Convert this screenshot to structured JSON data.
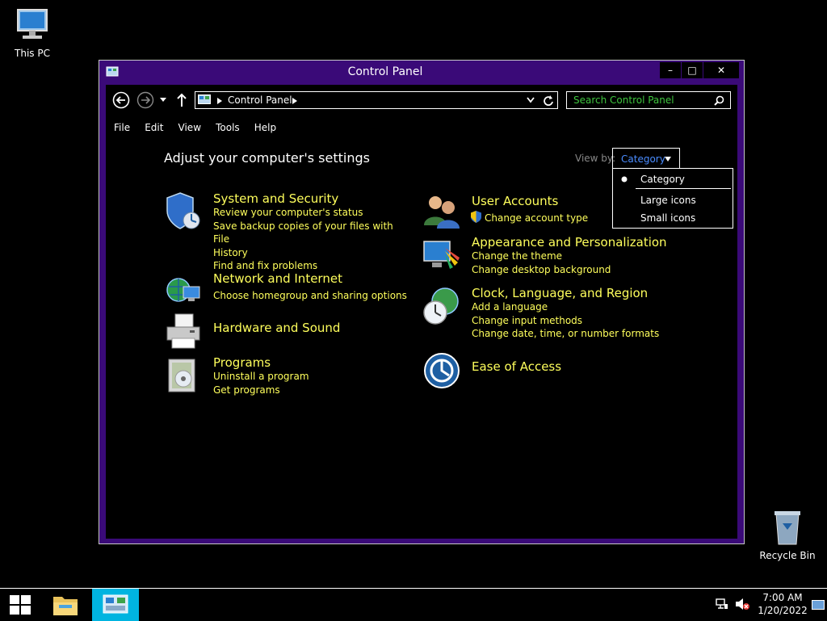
{
  "desktop": {
    "this_pc_label": "This PC",
    "recycle_bin_label": "Recycle Bin"
  },
  "window": {
    "title": "Control Panel",
    "controls": {
      "minimize": "–",
      "maximize": "□",
      "close": "✕"
    }
  },
  "address_bar": {
    "crumb": "Control Panel"
  },
  "search": {
    "placeholder": "Search Control Panel"
  },
  "menu": [
    "File",
    "Edit",
    "View",
    "Tools",
    "Help"
  ],
  "heading": "Adjust your computer's settings",
  "view_by": {
    "label": "View by:",
    "selected": "Category",
    "options": [
      "Category",
      "Large icons",
      "Small icons"
    ]
  },
  "categories_left": [
    {
      "title": "System and Security",
      "links": [
        "Review your computer's status",
        "Save backup copies of your files with File",
        "History",
        "Find and fix problems"
      ]
    },
    {
      "title": "Network and Internet",
      "links": [
        "Choose homegroup and sharing options"
      ]
    },
    {
      "title": "Hardware and Sound",
      "links": []
    },
    {
      "title": "Programs",
      "links": [
        "Uninstall a program",
        "Get programs"
      ]
    }
  ],
  "categories_right": [
    {
      "title": "User Accounts",
      "links": [
        "Change account type"
      ]
    },
    {
      "title": "Appearance and Personalization",
      "links": [
        "Change the theme",
        "Change desktop background"
      ]
    },
    {
      "title": "Clock, Language, and Region",
      "links": [
        "Add a language",
        "Change input methods",
        "Change date, time, or number formats"
      ]
    },
    {
      "title": "Ease of Access",
      "links": []
    }
  ],
  "taskbar": {
    "time": "7:00 AM",
    "date": "1/20/2022"
  },
  "colors": {
    "window_frame": "#3a0a78",
    "link": "#ffff5c",
    "search_placeholder": "#3ec43e",
    "dropdown_text": "#4a8cff"
  }
}
